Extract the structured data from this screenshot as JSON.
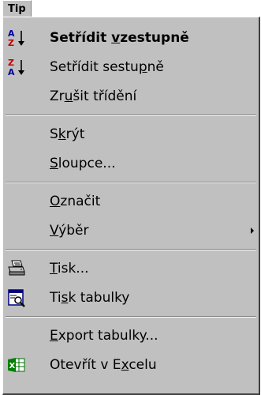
{
  "header": {
    "title": "Tip"
  },
  "menu": {
    "items": [
      {
        "label_pre": "Setřídit ",
        "mnemonic": "v",
        "label_post": "zestupně",
        "icon": "sort-ascending-icon",
        "bold": true
      },
      {
        "label_pre": "Setřídit sestu",
        "mnemonic": "p",
        "label_post": "ně",
        "icon": "sort-descending-icon",
        "bold": false
      },
      {
        "label_pre": "Zr",
        "mnemonic": "u",
        "label_post": "šit třídění",
        "icon": "",
        "bold": false
      },
      {
        "label_pre": "S",
        "mnemonic": "k",
        "label_post": "rýt",
        "icon": "",
        "bold": false
      },
      {
        "label_pre": "",
        "mnemonic": "S",
        "label_post": "loupce...",
        "icon": "",
        "bold": false
      },
      {
        "label_pre": "",
        "mnemonic": "O",
        "label_post": "značit",
        "icon": "",
        "bold": false
      },
      {
        "label_pre": "",
        "mnemonic": "V",
        "label_post": "ýběr",
        "icon": "",
        "bold": false,
        "submenu": true
      },
      {
        "label_pre": "",
        "mnemonic": "T",
        "label_post": "isk...",
        "icon": "printer-icon",
        "bold": false
      },
      {
        "label_pre": "Ti",
        "mnemonic": "s",
        "label_post": "k tabulky",
        "icon": "print-preview-icon",
        "bold": false
      },
      {
        "label_pre": "",
        "mnemonic": "E",
        "label_post": "xport tabulky...",
        "icon": "",
        "bold": false
      },
      {
        "label_pre": "Otevřít v E",
        "mnemonic": "x",
        "label_post": "celu",
        "icon": "excel-icon",
        "bold": false
      }
    ]
  }
}
